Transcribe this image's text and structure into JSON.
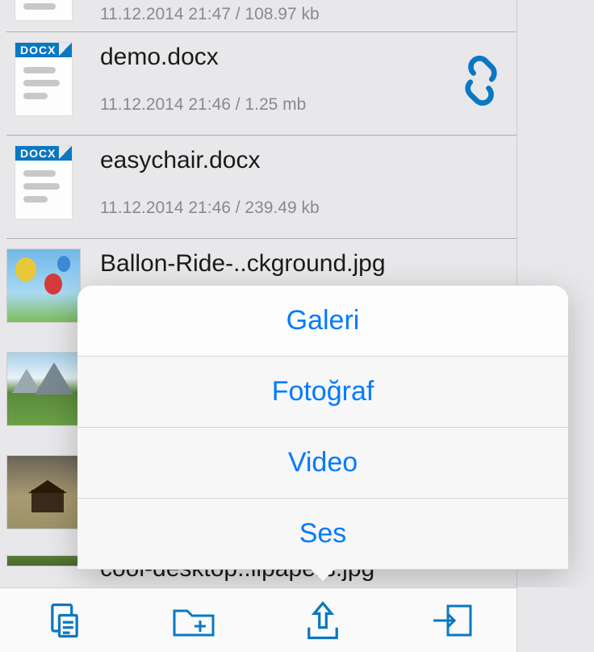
{
  "files": [
    {
      "name": "",
      "meta": "11.12.2014 21:47 / 108.97 kb",
      "type": "docx",
      "linked": false
    },
    {
      "name": "demo.docx",
      "meta": "11.12.2014 21:46 / 1.25 mb",
      "type": "docx",
      "linked": true
    },
    {
      "name": "easychair.docx",
      "meta": "11.12.2014 21:46 / 239.49 kb",
      "type": "docx",
      "linked": false
    },
    {
      "name": "Ballon-Ride-..ckground.jpg",
      "meta": "",
      "type": "image-balloon",
      "linked": false
    },
    {
      "name": "",
      "meta": "",
      "type": "image-landscape",
      "linked": false
    },
    {
      "name": "",
      "meta": "",
      "type": "image-cabin",
      "linked": false
    },
    {
      "name": "cool-desktop..llpapers.jpg",
      "meta": "",
      "type": "image-partial",
      "linked": false
    }
  ],
  "actionSheet": {
    "items": [
      "Galeri",
      "Fotoğraf",
      "Video",
      "Ses"
    ]
  },
  "docxLabel": "DOCX",
  "colors": {
    "accent": "#007aff",
    "iconBlue": "#0a78c2"
  }
}
